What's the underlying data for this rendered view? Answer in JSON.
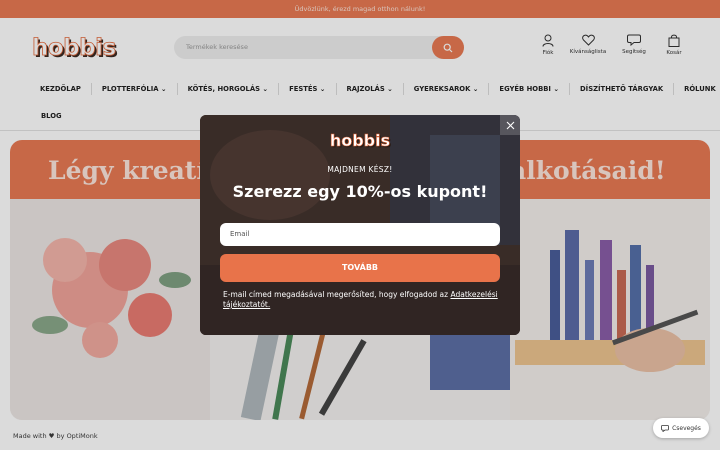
{
  "announcement": "Üdvözlünk, érezd magad otthon nálunk!",
  "brand": "hobbis",
  "search": {
    "placeholder": "Termékek keresése"
  },
  "header_icons": [
    {
      "label": "Fiók",
      "icon": "user-icon"
    },
    {
      "label": "Kívánságlista",
      "icon": "heart-icon"
    },
    {
      "label": "Segítség",
      "icon": "chat-bubble-icon"
    },
    {
      "label": "Kosár",
      "icon": "bag-icon"
    }
  ],
  "nav": {
    "row1": [
      {
        "label": "KEZDŐLAP"
      },
      {
        "label": "PLOTTERFÓLIA ⌄"
      },
      {
        "label": "KÖTÉS, HORGOLÁS ⌄"
      },
      {
        "label": "FESTÉS ⌄"
      },
      {
        "label": "RAJZOLÁS ⌄"
      },
      {
        "label": "GYEREKSAROK ⌄"
      },
      {
        "label": "EGYÉB HOBBI ⌄"
      },
      {
        "label": "DÍSZÍTHETŐ TÁRGYAK"
      },
      {
        "label": "RÓLUNK"
      }
    ],
    "row2": [
      {
        "label": "BLOG"
      }
    ]
  },
  "hero": {
    "title_left": "Légy kreatí",
    "title_right": "alkotásaid!"
  },
  "popup": {
    "logo": "hobbis",
    "subtitle": "MAJDNEM KÉSZ!",
    "headline": "Szerezz egy 10%-os kupont!",
    "email_placeholder": "Email",
    "button": "TOVÁBB",
    "note": "E-mail címed megadásával megerősíted, hogy elfogadod az",
    "note_link": "Adatkezelési tájékoztatót."
  },
  "footer_badge": "Made with ♥ by OptiMonk",
  "chat_label": "Csevegés",
  "colors": {
    "accent": "#e87a53",
    "band_text": "#fce6dc"
  }
}
